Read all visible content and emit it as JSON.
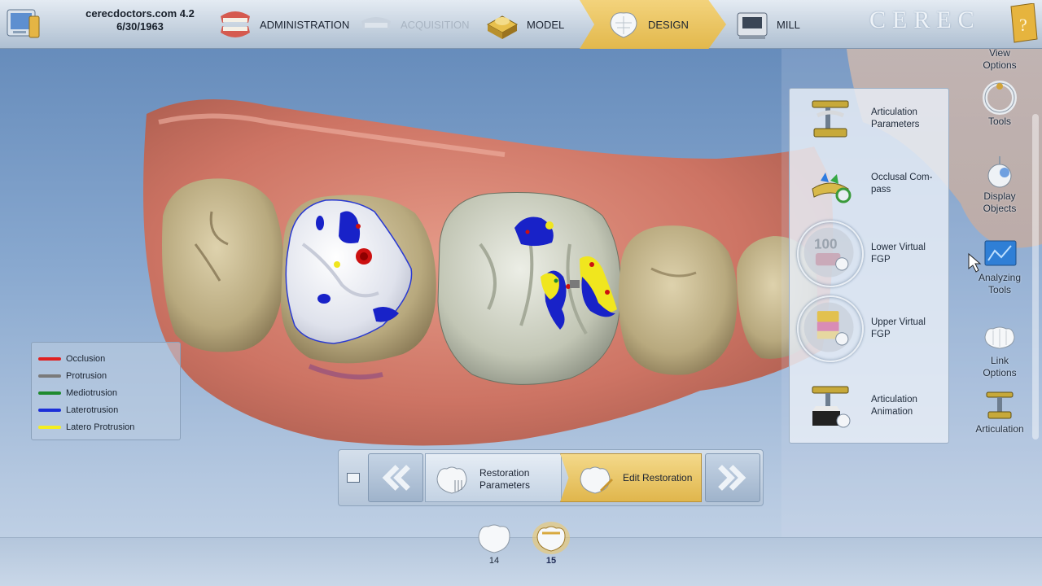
{
  "app": {
    "title_line1": "cerecdoctors.com 4.2",
    "title_line2": "6/30/1963",
    "brand": "CEREC"
  },
  "phases": [
    {
      "label": "ADMINISTRATION",
      "state": "normal"
    },
    {
      "label": "ACQUISITION",
      "state": "disabled"
    },
    {
      "label": "MODEL",
      "state": "normal"
    },
    {
      "label": "DESIGN",
      "state": "active"
    },
    {
      "label": "MILL",
      "state": "normal"
    }
  ],
  "legend": [
    {
      "label": "Occlusion",
      "color": "#e02020"
    },
    {
      "label": "Protrusion",
      "color": "#7a7a7a"
    },
    {
      "label": "Mediotrusion",
      "color": "#1f8a2e"
    },
    {
      "label": "Laterotrusion",
      "color": "#1c2fd8"
    },
    {
      "label": "Latero Protrusion",
      "color": "#f4ee21"
    }
  ],
  "popup": [
    {
      "label": "Articulation Parameters",
      "icon": "articulator-icon"
    },
    {
      "label": "Occlusal Com-pass",
      "icon": "occlusal-compass-icon"
    },
    {
      "label": "Lower Virtual FGP",
      "icon": "lower-fgp-icon",
      "badge": "100"
    },
    {
      "label": "Upper Virtual FGP",
      "icon": "upper-fgp-icon"
    },
    {
      "label": "Articulation Animation",
      "icon": "articulation-animation-icon"
    }
  ],
  "right_toolbar": {
    "view_options": "View Options",
    "tools": "Tools",
    "display_objects": "Display Objects",
    "analyzing_tools": "Analyzing Tools",
    "link_options": "Link Options",
    "articulation": "Articulation"
  },
  "steps": {
    "restoration_parameters": "Restoration Parameters",
    "edit_restoration": "Edit Restoration"
  },
  "teeth": [
    {
      "number": "14",
      "selected": false
    },
    {
      "number": "15",
      "selected": true
    }
  ],
  "colors": {
    "accent": "#e2b84c",
    "panel": "#c7d3e0"
  }
}
